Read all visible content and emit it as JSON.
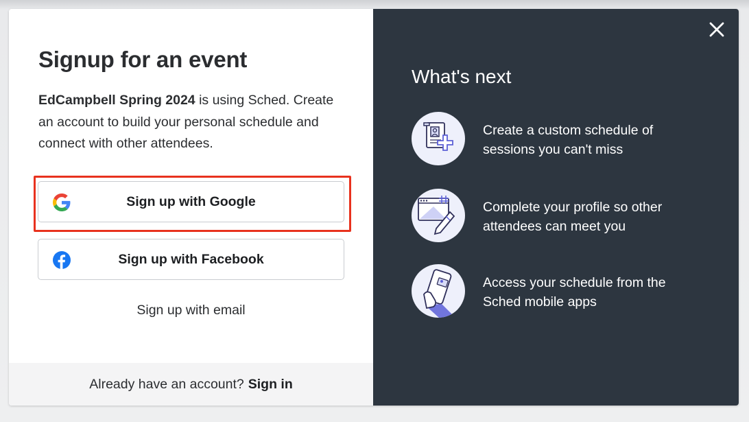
{
  "modal": {
    "title": "Signup for an event",
    "intro": {
      "event_name": "EdCampbell Spring 2024",
      "intro_suffix": " is using Sched.",
      "intro_rest": "Create an account to build your personal schedule and connect with other attendees."
    },
    "buttons": {
      "google_label": "Sign up with Google",
      "google_icon": "google-icon",
      "facebook_label": "Sign up with Facebook",
      "facebook_icon": "facebook-icon",
      "email_label": "Sign up with email"
    },
    "footer": {
      "prompt": "Already have an account?",
      "signin_label": "Sign in"
    },
    "highlight_color": "#e8321e"
  },
  "whats_next": {
    "title": "What's next",
    "items": [
      {
        "icon": "schedule-add-icon",
        "text": "Create a custom schedule of sessions you can't miss"
      },
      {
        "icon": "profile-edit-icon",
        "text": "Complete your profile so other attendees can meet you"
      },
      {
        "icon": "mobile-app-icon",
        "text": "Access your schedule from the Sched mobile apps"
      }
    ],
    "background": "#2d3640"
  },
  "close_icon": "close-icon"
}
